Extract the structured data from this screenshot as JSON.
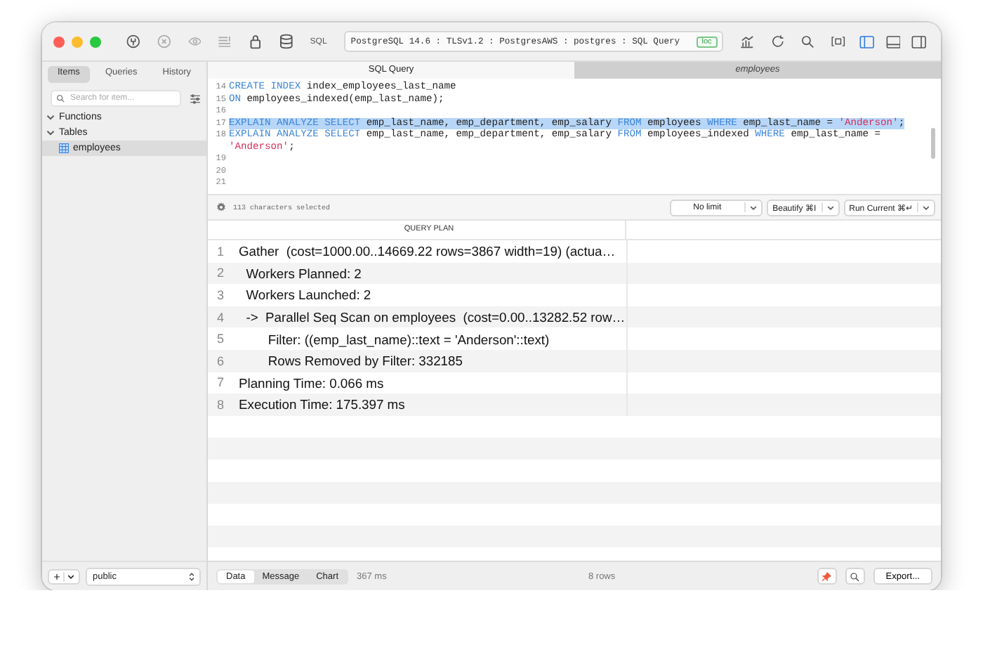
{
  "toolbar": {
    "sql_label": "SQL",
    "connection": "PostgreSQL 14.6 : TLSv1.2 : PostgresAWS : postgres : SQL Query",
    "badge": "loc",
    "panel_toggles": [
      {
        "selected": true
      },
      {
        "selected": false
      },
      {
        "selected": false
      }
    ]
  },
  "sidebar": {
    "segments": [
      {
        "label": "Items",
        "selected": true
      },
      {
        "label": "Queries",
        "selected": false
      },
      {
        "label": "History",
        "selected": false
      }
    ],
    "search": {
      "placeholder": "Search for item..."
    },
    "tree": [
      {
        "label": "Functions",
        "expanded": true,
        "selected": false
      },
      {
        "label": "Tables",
        "expanded": true,
        "selected": false,
        "children": [
          {
            "label": "employees",
            "selected": true
          }
        ]
      }
    ],
    "schema": "public"
  },
  "tabs": [
    {
      "label": "SQL Query",
      "selected": true
    },
    {
      "label": "employees",
      "selected": false
    }
  ],
  "editor": {
    "lines": [
      {
        "number": "14",
        "selected": false,
        "tokens": [
          {
            "kind": "keyword",
            "text": "CREATE INDEX"
          },
          {
            "kind": "plain",
            "text": " index_employees_last_name"
          }
        ]
      },
      {
        "number": "15",
        "selected": false,
        "tokens": [
          {
            "kind": "keyword",
            "text": "ON"
          },
          {
            "kind": "plain",
            "text": " employees_indexed(emp_last_name);"
          }
        ]
      },
      {
        "number": "16",
        "selected": false
      },
      {
        "number": "17",
        "selected": true,
        "tokens": [
          {
            "kind": "keyword",
            "text": "EXPLAIN ANALYZE SELECT"
          },
          {
            "kind": "plain",
            "text": " emp_last_name, emp_department, emp_salary "
          },
          {
            "kind": "keyword",
            "text": "FROM"
          },
          {
            "kind": "plain",
            "text": " employees "
          },
          {
            "kind": "keyword",
            "text": "WHERE"
          },
          {
            "kind": "plain",
            "text": " emp_last_name = "
          },
          {
            "kind": "string",
            "text": "'Anderson'"
          },
          {
            "kind": "plain",
            "text": ";"
          }
        ]
      },
      {
        "number": "18",
        "selected": false,
        "tokens": [
          {
            "kind": "keyword",
            "text": "EXPLAIN ANALYZE SELECT"
          },
          {
            "kind": "plain",
            "text": " emp_last_name, emp_department, emp_salary "
          },
          {
            "kind": "keyword",
            "text": "FROM"
          },
          {
            "kind": "plain",
            "text": " employees_indexed "
          },
          {
            "kind": "keyword",
            "text": "WHERE"
          },
          {
            "kind": "plain",
            "text": " emp_last_name = "
          },
          {
            "kind": "string",
            "text": "'Anderson'"
          },
          {
            "kind": "plain",
            "text": ";"
          }
        ]
      },
      {
        "number": "19",
        "selected": false
      },
      {
        "number": "20",
        "selected": false
      },
      {
        "number": "21",
        "selected": false
      }
    ],
    "status": "113 characters selected",
    "buttons": [
      "No limit",
      "Beautify ⌘I",
      "Run Current ⌘↵"
    ]
  },
  "results": {
    "columns": [
      "QUERY PLAN"
    ],
    "rows": [
      {
        "number": "1",
        "text": "Gather  (cost=1000.00..14669.22 rows=3867 width=19) (actua…"
      },
      {
        "number": "2",
        "text": "  Workers Planned: 2"
      },
      {
        "number": "3",
        "text": "  Workers Launched: 2"
      },
      {
        "number": "4",
        "text": "  ->  Parallel Seq Scan on employees  (cost=0.00..13282.52 row…"
      },
      {
        "number": "5",
        "text": "        Filter: ((emp_last_name)::text = 'Anderson'::text)"
      },
      {
        "number": "6",
        "text": "        Rows Removed by Filter: 332185"
      },
      {
        "number": "7",
        "text": "Planning Time: 0.066 ms"
      },
      {
        "number": "8",
        "text": "Execution Time: 175.397 ms"
      }
    ]
  },
  "bottom_bar": {
    "views": [
      {
        "label": "Data",
        "selected": true
      },
      {
        "label": "Message",
        "selected": false
      },
      {
        "label": "Chart",
        "selected": false
      }
    ],
    "duration": "367 ms",
    "row_count": "8 rows",
    "export": "Export..."
  }
}
